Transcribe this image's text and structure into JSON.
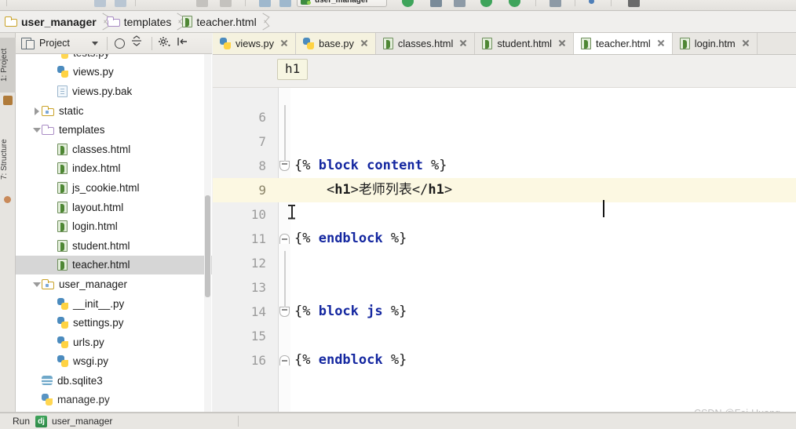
{
  "window": {
    "breadcrumb": [
      {
        "label": "user_manager",
        "icon": "folder-icon",
        "bold": true
      },
      {
        "label": "templates",
        "icon": "folder-icon",
        "bold": false
      },
      {
        "label": "teacher.html",
        "icon": "html-file-icon",
        "bold": false
      }
    ],
    "run_config_label": "user_manager"
  },
  "left_rail": {
    "tabs": [
      {
        "label": "1: Project",
        "selected": true
      },
      {
        "label": "7: Structure",
        "selected": false
      }
    ]
  },
  "project_panel": {
    "title": "Project",
    "toolbar_icons": [
      "locate-icon",
      "collapse-all-icon",
      "settings-icon",
      "hide-icon"
    ],
    "tree": [
      {
        "label": "tests.py",
        "icon": "python-file-icon",
        "indent": 2,
        "arrow": "none",
        "selected": false,
        "clipped": true
      },
      {
        "label": "views.py",
        "icon": "python-file-icon",
        "indent": 2,
        "arrow": "none",
        "selected": false
      },
      {
        "label": "views.py.bak",
        "icon": "text-file-icon",
        "indent": 2,
        "arrow": "none",
        "selected": false
      },
      {
        "label": "static",
        "icon": "folder-dot-icon",
        "indent": 1,
        "arrow": "collapsed",
        "selected": false
      },
      {
        "label": "templates",
        "icon": "folder-icon",
        "indent": 1,
        "arrow": "expanded",
        "selected": false
      },
      {
        "label": "classes.html",
        "icon": "html-file-icon",
        "indent": 2,
        "arrow": "none",
        "selected": false
      },
      {
        "label": "index.html",
        "icon": "html-file-icon",
        "indent": 2,
        "arrow": "none",
        "selected": false
      },
      {
        "label": "js_cookie.html",
        "icon": "html-file-icon",
        "indent": 2,
        "arrow": "none",
        "selected": false
      },
      {
        "label": "layout.html",
        "icon": "html-file-icon",
        "indent": 2,
        "arrow": "none",
        "selected": false
      },
      {
        "label": "login.html",
        "icon": "html-file-icon",
        "indent": 2,
        "arrow": "none",
        "selected": false
      },
      {
        "label": "student.html",
        "icon": "html-file-icon",
        "indent": 2,
        "arrow": "none",
        "selected": false
      },
      {
        "label": "teacher.html",
        "icon": "html-file-icon",
        "indent": 2,
        "arrow": "none",
        "selected": true
      },
      {
        "label": "user_manager",
        "icon": "folder-dot-icon",
        "indent": 1,
        "arrow": "expanded",
        "selected": false
      },
      {
        "label": "__init__.py",
        "icon": "python-file-icon",
        "indent": 2,
        "arrow": "none",
        "selected": false
      },
      {
        "label": "settings.py",
        "icon": "python-file-icon",
        "indent": 2,
        "arrow": "none",
        "selected": false
      },
      {
        "label": "urls.py",
        "icon": "python-file-icon",
        "indent": 2,
        "arrow": "none",
        "selected": false
      },
      {
        "label": "wsgi.py",
        "icon": "python-file-icon",
        "indent": 2,
        "arrow": "none",
        "selected": false
      },
      {
        "label": "db.sqlite3",
        "icon": "database-icon",
        "indent": 1,
        "arrow": "none",
        "selected": false
      },
      {
        "label": "manage.py",
        "icon": "python-file-icon",
        "indent": 1,
        "arrow": "none",
        "selected": false,
        "clipped": true
      }
    ]
  },
  "editor": {
    "tabs": [
      {
        "label": "views.py",
        "icon": "python-file-icon",
        "active": false,
        "kind": "py"
      },
      {
        "label": "base.py",
        "icon": "python-file-icon",
        "active": false,
        "kind": "py"
      },
      {
        "label": "classes.html",
        "icon": "html-file-icon",
        "active": false,
        "kind": "html"
      },
      {
        "label": "student.html",
        "icon": "html-file-icon",
        "active": false,
        "kind": "html"
      },
      {
        "label": "teacher.html",
        "icon": "html-file-icon",
        "active": true,
        "kind": "html"
      },
      {
        "label": "login.htm",
        "icon": "html-file-icon",
        "active": false,
        "kind": "html"
      }
    ],
    "structure_crumb": "h1",
    "lines": [
      {
        "num": "6",
        "text": "",
        "fold": "none",
        "highlight": false
      },
      {
        "num": "7",
        "text": "",
        "fold": "none",
        "highlight": false
      },
      {
        "num": "8",
        "text": "{% block content %}",
        "fold": "open",
        "highlight": false
      },
      {
        "num": "9",
        "text": "    <h1>老师列表</h1>",
        "fold": "none",
        "highlight": true
      },
      {
        "num": "10",
        "text": "",
        "fold": "none",
        "highlight": false
      },
      {
        "num": "11",
        "text": "{% endblock %}",
        "fold": "close",
        "highlight": false
      },
      {
        "num": "12",
        "text": "",
        "fold": "none",
        "highlight": false
      },
      {
        "num": "13",
        "text": "",
        "fold": "none",
        "highlight": false
      },
      {
        "num": "14",
        "text": "{% block js %}",
        "fold": "open",
        "highlight": false
      },
      {
        "num": "15",
        "text": "",
        "fold": "none",
        "highlight": false
      },
      {
        "num": "16",
        "text": "{% endblock %}",
        "fold": "close",
        "highlight": false
      }
    ]
  },
  "status_bar": {
    "run_label": "Run",
    "run_icon": "django-icon",
    "config_name": "user_manager",
    "watermark": "CSDN @Fei-Huang"
  },
  "colors": {
    "accent_keyword": "#1427a0",
    "highlight_line": "#fcf8e2",
    "selected_row": "#d6d6d6",
    "chrome": "#e8e6e2"
  }
}
